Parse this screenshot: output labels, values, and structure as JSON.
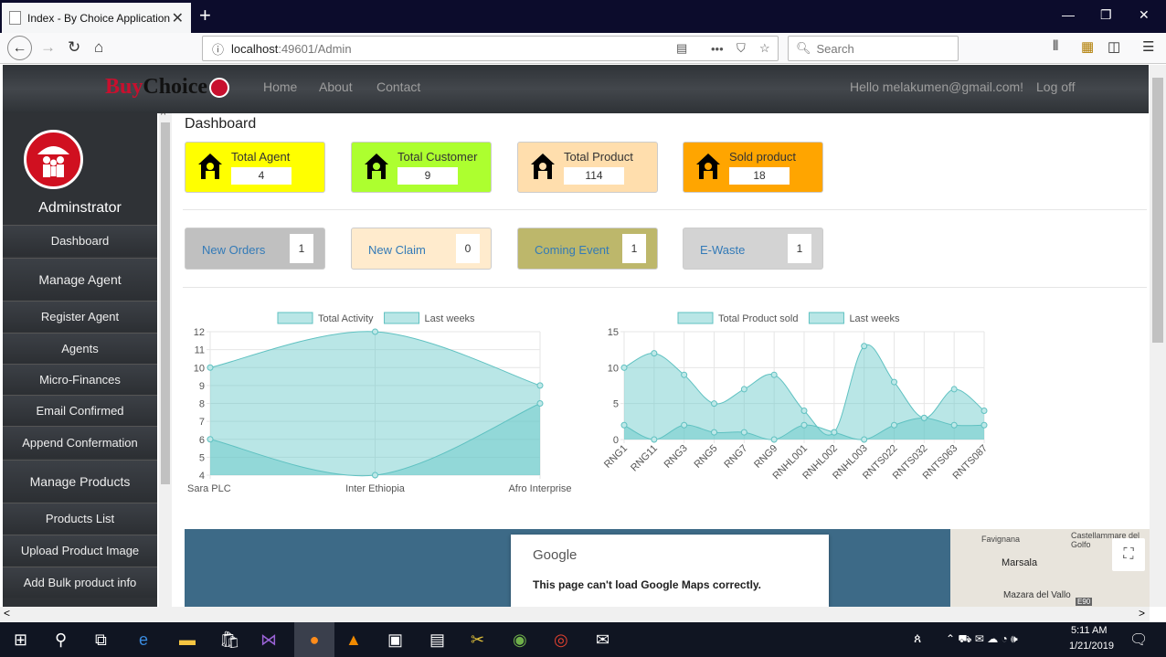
{
  "browser": {
    "tab_title": "Index - By Choice Application",
    "url_host": "localhost",
    "url_path": ":49601/Admin",
    "search_placeholder": "Search"
  },
  "site": {
    "logo_part1": "Buy",
    "logo_part2": "Choice",
    "nav": [
      "Home",
      "About",
      "Contact"
    ],
    "greeting": "Hello melakumen@gmail.com!",
    "logoff": "Log off"
  },
  "sidebar": {
    "title": "Adminstrator",
    "items": [
      "Dashboard",
      "Manage Agent",
      "Register Agent",
      "Agents",
      "Micro-Finances",
      "Email Confirmed",
      "Append Confermation",
      "Manage Products",
      "Products List",
      "Upload Product Image",
      "Add Bulk product info"
    ]
  },
  "main": {
    "title": "Dashboard",
    "cards": [
      {
        "label": "Total Agent",
        "value": "4",
        "color": "#ffff00"
      },
      {
        "label": "Total Customer",
        "value": "9",
        "color": "#adff2f"
      },
      {
        "label": "Total Product",
        "value": "114",
        "color": "#ffdead"
      },
      {
        "label": "Sold product",
        "value": "18",
        "color": "#ffa500"
      }
    ],
    "pills": [
      {
        "label": "New Orders",
        "value": "1",
        "color": "#c0c0c0"
      },
      {
        "label": "New Claim",
        "value": "0",
        "color": "#ffebcd"
      },
      {
        "label": "Coming Event",
        "value": "1",
        "color": "#bdb76b"
      },
      {
        "label": "E-Waste",
        "value": "1",
        "color": "#d3d3d3"
      }
    ]
  },
  "chart_data": [
    {
      "type": "area",
      "categories": [
        "Sara PLC",
        "Inter Ethiopia",
        "Afro Interprise"
      ],
      "series": [
        {
          "name": "Total Activity",
          "values": [
            10,
            12,
            9
          ]
        },
        {
          "name": "Last weeks",
          "values": [
            6,
            4,
            8
          ]
        }
      ],
      "ylim": [
        4,
        12
      ],
      "yticks": [
        "12",
        "11",
        "10",
        "9",
        "8",
        "7",
        "6",
        "5",
        "4"
      ],
      "legend": "top"
    },
    {
      "type": "area",
      "categories": [
        "RNG1",
        "RNG11",
        "RNG3",
        "RNG5",
        "RNG7",
        "RNG9",
        "RNHL001",
        "RNHL002",
        "RNHL003",
        "RNTS022",
        "RNTS032",
        "RNTS063",
        "RNTS087"
      ],
      "series": [
        {
          "name": "Total Product sold",
          "values": [
            10,
            12,
            9,
            5,
            7,
            9,
            4,
            1,
            13,
            8,
            3,
            7,
            4
          ]
        },
        {
          "name": "Last weeks",
          "values": [
            2,
            0,
            2,
            1,
            1,
            0,
            2,
            1,
            0,
            2,
            3,
            2,
            2
          ]
        }
      ],
      "ylim": [
        0,
        15
      ],
      "yticks": [
        "15",
        "10",
        "5",
        "0"
      ],
      "legend": "top"
    }
  ],
  "map": {
    "brand": "Google",
    "message": "This page can't load Google Maps correctly.",
    "places": [
      "Favignana",
      "Castellammare del Golfo",
      "Marsala",
      "Mazara del Vallo",
      "E90"
    ]
  },
  "taskbar": {
    "time": "5:11 AM",
    "date": "1/21/2019"
  }
}
